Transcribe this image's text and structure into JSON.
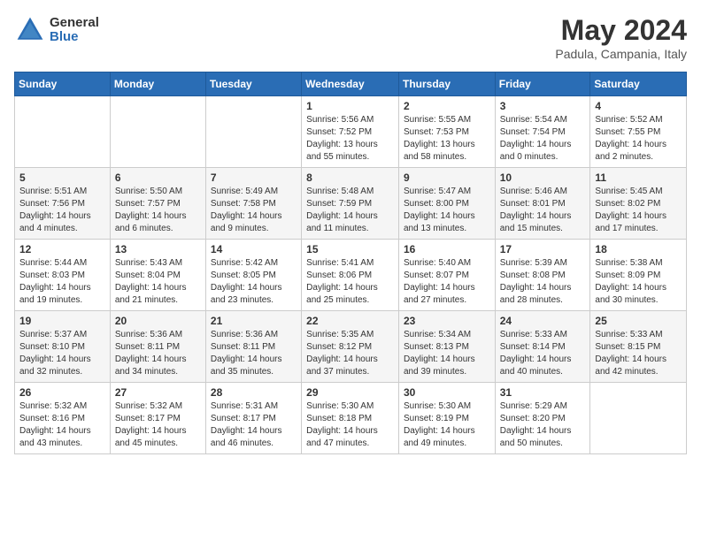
{
  "header": {
    "logo_general": "General",
    "logo_blue": "Blue",
    "title": "May 2024",
    "location": "Padula, Campania, Italy"
  },
  "weekdays": [
    "Sunday",
    "Monday",
    "Tuesday",
    "Wednesday",
    "Thursday",
    "Friday",
    "Saturday"
  ],
  "weeks": [
    [
      {
        "day": "",
        "info": ""
      },
      {
        "day": "",
        "info": ""
      },
      {
        "day": "",
        "info": ""
      },
      {
        "day": "1",
        "info": "Sunrise: 5:56 AM\nSunset: 7:52 PM\nDaylight: 13 hours\nand 55 minutes."
      },
      {
        "day": "2",
        "info": "Sunrise: 5:55 AM\nSunset: 7:53 PM\nDaylight: 13 hours\nand 58 minutes."
      },
      {
        "day": "3",
        "info": "Sunrise: 5:54 AM\nSunset: 7:54 PM\nDaylight: 14 hours\nand 0 minutes."
      },
      {
        "day": "4",
        "info": "Sunrise: 5:52 AM\nSunset: 7:55 PM\nDaylight: 14 hours\nand 2 minutes."
      }
    ],
    [
      {
        "day": "5",
        "info": "Sunrise: 5:51 AM\nSunset: 7:56 PM\nDaylight: 14 hours\nand 4 minutes."
      },
      {
        "day": "6",
        "info": "Sunrise: 5:50 AM\nSunset: 7:57 PM\nDaylight: 14 hours\nand 6 minutes."
      },
      {
        "day": "7",
        "info": "Sunrise: 5:49 AM\nSunset: 7:58 PM\nDaylight: 14 hours\nand 9 minutes."
      },
      {
        "day": "8",
        "info": "Sunrise: 5:48 AM\nSunset: 7:59 PM\nDaylight: 14 hours\nand 11 minutes."
      },
      {
        "day": "9",
        "info": "Sunrise: 5:47 AM\nSunset: 8:00 PM\nDaylight: 14 hours\nand 13 minutes."
      },
      {
        "day": "10",
        "info": "Sunrise: 5:46 AM\nSunset: 8:01 PM\nDaylight: 14 hours\nand 15 minutes."
      },
      {
        "day": "11",
        "info": "Sunrise: 5:45 AM\nSunset: 8:02 PM\nDaylight: 14 hours\nand 17 minutes."
      }
    ],
    [
      {
        "day": "12",
        "info": "Sunrise: 5:44 AM\nSunset: 8:03 PM\nDaylight: 14 hours\nand 19 minutes."
      },
      {
        "day": "13",
        "info": "Sunrise: 5:43 AM\nSunset: 8:04 PM\nDaylight: 14 hours\nand 21 minutes."
      },
      {
        "day": "14",
        "info": "Sunrise: 5:42 AM\nSunset: 8:05 PM\nDaylight: 14 hours\nand 23 minutes."
      },
      {
        "day": "15",
        "info": "Sunrise: 5:41 AM\nSunset: 8:06 PM\nDaylight: 14 hours\nand 25 minutes."
      },
      {
        "day": "16",
        "info": "Sunrise: 5:40 AM\nSunset: 8:07 PM\nDaylight: 14 hours\nand 27 minutes."
      },
      {
        "day": "17",
        "info": "Sunrise: 5:39 AM\nSunset: 8:08 PM\nDaylight: 14 hours\nand 28 minutes."
      },
      {
        "day": "18",
        "info": "Sunrise: 5:38 AM\nSunset: 8:09 PM\nDaylight: 14 hours\nand 30 minutes."
      }
    ],
    [
      {
        "day": "19",
        "info": "Sunrise: 5:37 AM\nSunset: 8:10 PM\nDaylight: 14 hours\nand 32 minutes."
      },
      {
        "day": "20",
        "info": "Sunrise: 5:36 AM\nSunset: 8:11 PM\nDaylight: 14 hours\nand 34 minutes."
      },
      {
        "day": "21",
        "info": "Sunrise: 5:36 AM\nSunset: 8:11 PM\nDaylight: 14 hours\nand 35 minutes."
      },
      {
        "day": "22",
        "info": "Sunrise: 5:35 AM\nSunset: 8:12 PM\nDaylight: 14 hours\nand 37 minutes."
      },
      {
        "day": "23",
        "info": "Sunrise: 5:34 AM\nSunset: 8:13 PM\nDaylight: 14 hours\nand 39 minutes."
      },
      {
        "day": "24",
        "info": "Sunrise: 5:33 AM\nSunset: 8:14 PM\nDaylight: 14 hours\nand 40 minutes."
      },
      {
        "day": "25",
        "info": "Sunrise: 5:33 AM\nSunset: 8:15 PM\nDaylight: 14 hours\nand 42 minutes."
      }
    ],
    [
      {
        "day": "26",
        "info": "Sunrise: 5:32 AM\nSunset: 8:16 PM\nDaylight: 14 hours\nand 43 minutes."
      },
      {
        "day": "27",
        "info": "Sunrise: 5:32 AM\nSunset: 8:17 PM\nDaylight: 14 hours\nand 45 minutes."
      },
      {
        "day": "28",
        "info": "Sunrise: 5:31 AM\nSunset: 8:17 PM\nDaylight: 14 hours\nand 46 minutes."
      },
      {
        "day": "29",
        "info": "Sunrise: 5:30 AM\nSunset: 8:18 PM\nDaylight: 14 hours\nand 47 minutes."
      },
      {
        "day": "30",
        "info": "Sunrise: 5:30 AM\nSunset: 8:19 PM\nDaylight: 14 hours\nand 49 minutes."
      },
      {
        "day": "31",
        "info": "Sunrise: 5:29 AM\nSunset: 8:20 PM\nDaylight: 14 hours\nand 50 minutes."
      },
      {
        "day": "",
        "info": ""
      }
    ]
  ]
}
